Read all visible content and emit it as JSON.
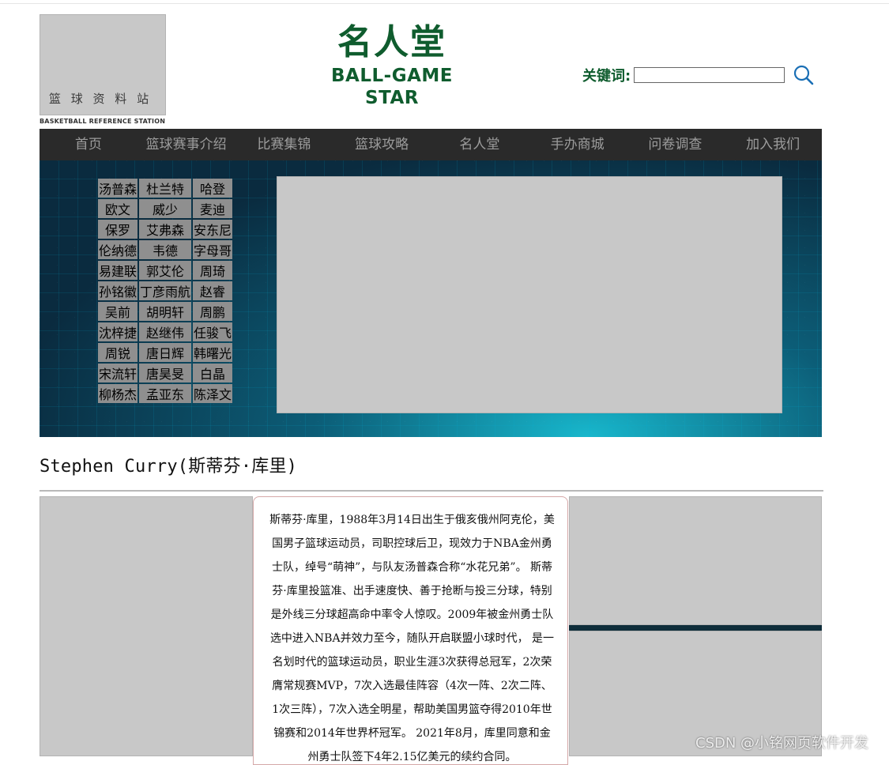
{
  "header": {
    "logo_cn": "篮 球 资 料 站",
    "logo_en": "BASKETBALL REFERENCE STATION",
    "title_cn": "名人堂",
    "title_en": "BALL-GAME STAR",
    "search_label": "关键词:",
    "search_value": "",
    "search_icon": "search-icon"
  },
  "nav": [
    "首页",
    "篮球赛事介绍",
    "比赛集锦",
    "篮球攻略",
    "名人堂",
    "手办商城",
    "问卷调查",
    "加入我们"
  ],
  "players": [
    [
      "汤普森",
      "杜兰特",
      "哈登"
    ],
    [
      "欧文",
      "威少",
      "麦迪"
    ],
    [
      "保罗",
      "艾弗森",
      "安东尼"
    ],
    [
      "伦纳德",
      "韦德",
      "字母哥"
    ],
    [
      "易建联",
      "郭艾伦",
      "周琦"
    ],
    [
      "孙铭徽",
      "丁彦雨航",
      "赵睿"
    ],
    [
      "吴前",
      "胡明轩",
      "周鹏"
    ],
    [
      "沈梓捷",
      "赵继伟",
      "任骏飞"
    ],
    [
      "周锐",
      "唐日辉",
      "韩曙光"
    ],
    [
      "宋流轩",
      "唐昊旻",
      "白晶"
    ],
    [
      "柳杨杰",
      "孟亚东",
      "陈泽文"
    ]
  ],
  "player": {
    "title": "Stephen Curry(斯蒂芬·库里)",
    "bio": "斯蒂芬·库里，1988年3月14日出生于俄亥俄州阿克伦，美国男子篮球运动员，司职控球后卫，现效力于NBA金州勇士队，绰号“萌神”，与队友汤普森合称“水花兄弟”。 斯蒂芬·库里投篮准、出手速度快、善于抢断与投三分球，特别是外线三分球超高命中率令人惊叹。2009年被金州勇士队选中进入NBA并效力至今，随队开启联盟小球时代， 是一名划时代的篮球运动员，职业生涯3次获得总冠军，2次荣膺常规赛MVP，7次入选最佳阵容（4次一阵、2次二阵、1次三阵），7次入选全明星，帮助美国男篮夺得2010年世锦赛和2014年世界杯冠军。 2021年8月，库里同意和金州勇士队签下4年2.15亿美元的续约合同。"
  },
  "watermark": "CSDN @小铭网页软件开发"
}
